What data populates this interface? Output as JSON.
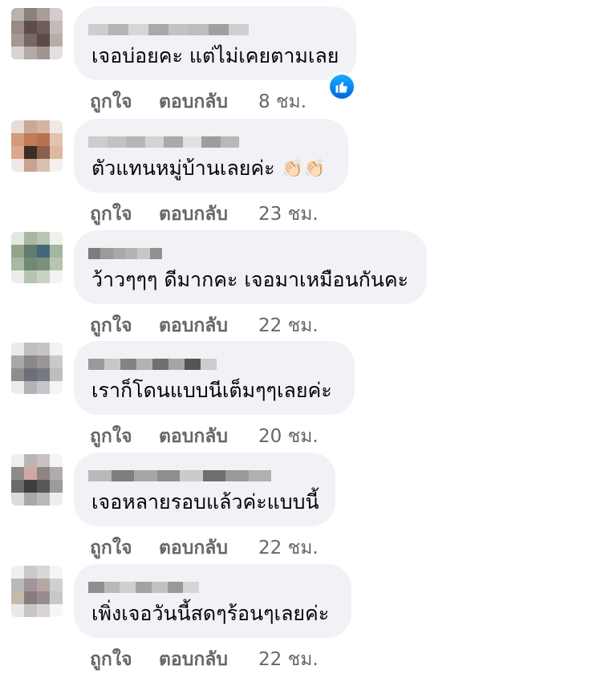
{
  "comments": [
    {
      "text": "เจอบ่อยคะ แต่ไม่เคยตามเลย",
      "emoji": "",
      "like": "ถูกใจ",
      "reply": "ตอบกลับ",
      "time": "8 ชม.",
      "has_like_reaction": true,
      "avatar_colors": [
        "#b8b2b0",
        "#8d7f7a",
        "#a89d98",
        "#d2cdca",
        "#9a8985",
        "#5d4c48",
        "#6f5d58",
        "#c4bbb8",
        "#a49794",
        "#776661",
        "#5b4a46",
        "#b6aca8",
        "#d8d4d2",
        "#b3aaa6",
        "#a0958f",
        "#e2dfde"
      ],
      "name_colors": [
        "#cdcdcd",
        "#b5b5b5",
        "#d6d6d6",
        "#a9a9a9",
        "#c2c2c2",
        "#bdbdbd",
        "#9f9f9f",
        "#cfcfcf"
      ]
    },
    {
      "text": "ตัวแทนหมู่บ้านเลยค่ะ",
      "emoji": "👏🏻👏🏻",
      "like": "ถูกใจ",
      "reply": "ตอบกลับ",
      "time": "23 ชม.",
      "has_like_reaction": false,
      "avatar_colors": [
        "#e8dcd3",
        "#c9a995",
        "#d3b6a2",
        "#efe8e3",
        "#d39a7c",
        "#c27b59",
        "#b8724f",
        "#e3c2b0",
        "#dba98f",
        "#3c2d28",
        "#8a5f4c",
        "#dfb8a2",
        "#f0e8e3",
        "#c9a291",
        "#d9c0b3",
        "#f5f0ed"
      ],
      "name_colors": [
        "#cdcdcd",
        "#c2c2c2",
        "#b5b5b5",
        "#d3d3d3",
        "#aaaaaa",
        "#e0e0e0",
        "#9d9d9d",
        "#b8b8b8"
      ]
    },
    {
      "text": "ว้าวๆๆๆ ดีมากคะ เจอมาเหมือนกันคะ",
      "emoji": "",
      "like": "ถูกใจ",
      "reply": "ตอบกลับ",
      "time": "22 ชม.",
      "has_like_reaction": false,
      "avatar_colors": [
        "#e3e7e0",
        "#a9b7a1",
        "#b9c5b3",
        "#eef1ec",
        "#93a48b",
        "#5f7c6f",
        "#44687a",
        "#a5b69f",
        "#a8b8a2",
        "#6f8a74",
        "#7b907a",
        "#b7c4b1",
        "#eaede8",
        "#b8c4b3",
        "#c8d1c4",
        "#f2f4f1"
      ],
      "name_colors": [
        "#7d7d7d",
        "#9b9b9b",
        "#a8a8a8",
        "#b3b3b3",
        "#c6c6c6",
        "#919191"
      ]
    },
    {
      "text": "เราก็โดนแบบนีเต็มๆๆเลยค่ะ",
      "emoji": "",
      "like": "ถูกใจ",
      "reply": "ตอบกลับ",
      "time": "20 ชม.",
      "has_like_reaction": false,
      "avatar_colors": [
        "#ebebeb",
        "#bfbfbf",
        "#c7c4c4",
        "#f2f2f2",
        "#a9a9a9",
        "#888888",
        "#9b9696",
        "#c9c9c9",
        "#8d8d8d",
        "#6c6f78",
        "#757985",
        "#bdbdbd",
        "#ececec",
        "#b2b2b6",
        "#c5c5ca",
        "#f4f4f4"
      ],
      "name_colors": [
        "#9a9a9a",
        "#c7c7c7",
        "#838383",
        "#b2b2b2",
        "#6f6f6f",
        "#a5a5a5",
        "#545454",
        "#cccccc"
      ]
    },
    {
      "text": "เจอหลายรอบแล้วค่ะแบบนี้",
      "emoji": "",
      "like": "ถูกใจ",
      "reply": "ตอบกลับ",
      "time": "22 ชม.",
      "has_like_reaction": false,
      "avatar_colors": [
        "#eeeeee",
        "#bbb6b5",
        "#c8c3c2",
        "#f4f4f4",
        "#8f8a89",
        "#d0a7a4",
        "#8f8684",
        "#b1acab",
        "#6c6b6b",
        "#3f3f3f",
        "#585858",
        "#9c9c9c",
        "#dbdbdb",
        "#a8a8a8",
        "#b9b9b9",
        "#eeeeee"
      ],
      "name_colors": [
        "#b9b9b9",
        "#7e7e7e",
        "#a6a6a6",
        "#8e8e8e",
        "#cbcbcb",
        "#6f6f6f",
        "#9a9a9a",
        "#b0b0b0"
      ]
    },
    {
      "text": "เพิ่งเจอวันนี้สดๆร้อนๆเลยค่ะ",
      "emoji": "",
      "like": "ถูกใจ",
      "reply": "ตอบกลับ",
      "time": "22 ชม.",
      "has_like_reaction": false,
      "avatar_colors": [
        "#efefef",
        "#cacaca",
        "#d8d6d6",
        "#f5f5f5",
        "#b9b9b9",
        "#a0969b",
        "#b6a6a4",
        "#d0d0d0",
        "#c5b9a9",
        "#887c7f",
        "#9a8c8e",
        "#c8c8c8",
        "#e8e8e8",
        "#c9c5c5",
        "#d9d5d5",
        "#f6f6f6"
      ],
      "name_colors": [
        "#8f8f8f",
        "#b8b8b8",
        "#cfcfcf",
        "#a2a2a2",
        "#c2c2c2",
        "#999999",
        "#d6d6d6"
      ]
    }
  ]
}
